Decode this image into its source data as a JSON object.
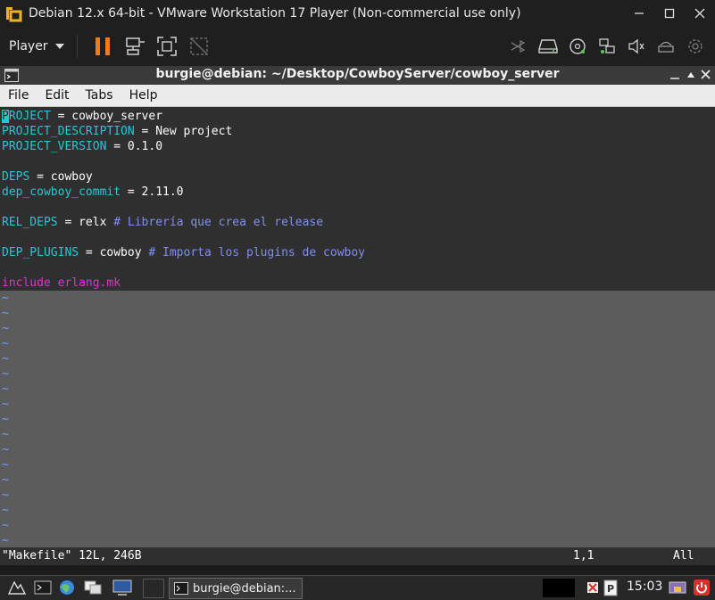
{
  "vmware": {
    "window_title": "Debian 12.x 64-bit - VMware Workstation 17 Player (Non-commercial use only)",
    "player_menu_label": "Player"
  },
  "terminal": {
    "title": "burgie@debian: ~/Desktop/CowboyServer/cowboy_server",
    "menu": [
      "File",
      "Edit",
      "Tabs",
      "Help"
    ]
  },
  "editor": {
    "cursor_char": "P",
    "lines": {
      "project_rest": "ROJECT",
      "project_val": " = cowboy_server",
      "desc_var": "PROJECT_DESCRIPTION",
      "desc_val": " = New project",
      "ver_var": "PROJECT_VERSION",
      "ver_val": " = 0.1.0",
      "deps_var": "DEPS",
      "deps_val": " = cowboy",
      "commit_var": "dep_cowboy_commit",
      "commit_val": " = 2.11.0",
      "reldeps_var": "REL_DEPS",
      "reldeps_val": " = relx ",
      "reldeps_cmt": "# Librería que crea el release",
      "plugins_var": "DEP_PLUGINS",
      "plugins_val": " = cowboy ",
      "plugins_cmt": "# Importa los plugins de cowboy",
      "include_kw": "include",
      "include_rest": " erlang.mk"
    },
    "tilde": "~",
    "status_file": "\"Makefile\" 12L, 246B",
    "status_pos": "1,1",
    "status_scroll": "All"
  },
  "taskbar": {
    "task_label": "burgie@debian:...",
    "clock": "15:03"
  },
  "colors": {
    "vmware_bar": "#1f1f1f",
    "variable": "#21c8d8",
    "comment": "#7f8ff0",
    "keyword": "#e52ce0",
    "pause_orange": "#f07b1e",
    "power_red": "#d9302c"
  }
}
